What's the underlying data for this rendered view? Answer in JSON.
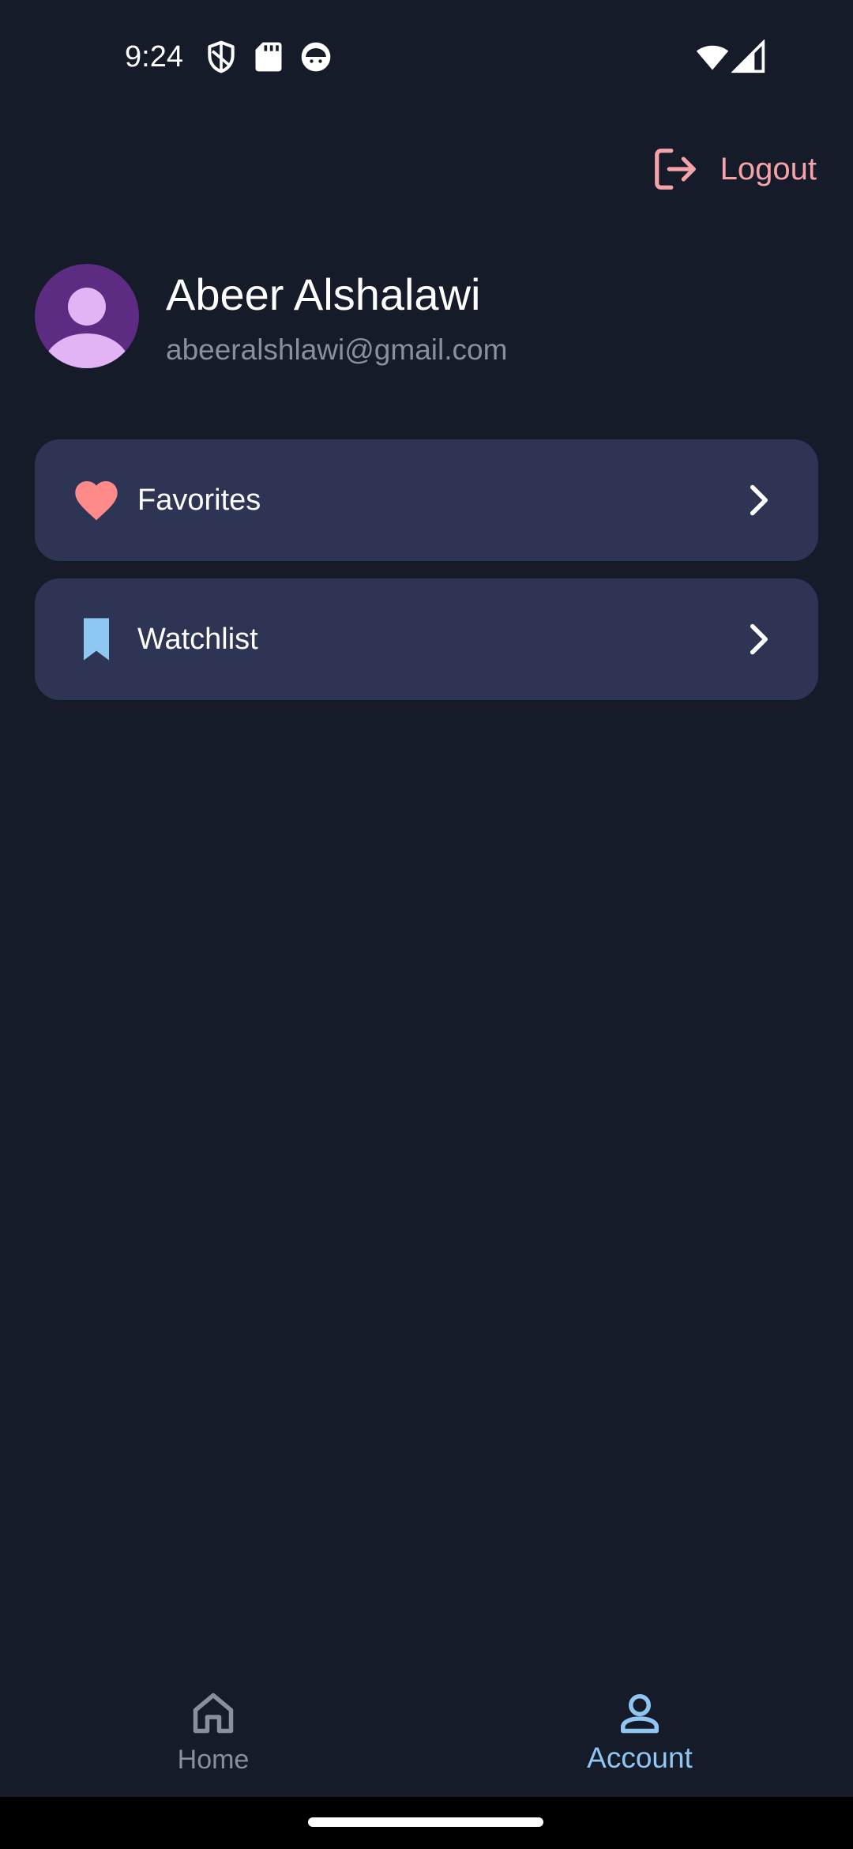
{
  "status_bar": {
    "time": "9:24",
    "icons": [
      "shield-icon",
      "sd-card-icon",
      "face-icon",
      "wifi-icon",
      "signal-icon"
    ]
  },
  "header": {
    "logout_label": "Logout",
    "logout_icon": "logout-icon"
  },
  "profile": {
    "name": "Abeer Alshalawi",
    "email": "abeeralshlawi@gmail.com",
    "avatar_icon": "person-icon"
  },
  "menu": {
    "items": [
      {
        "label": "Favorites",
        "icon": "heart-icon",
        "icon_color": "#ff8a8a"
      },
      {
        "label": "Watchlist",
        "icon": "bookmark-icon",
        "icon_color": "#8fc7f2"
      }
    ]
  },
  "bottom_nav": {
    "items": [
      {
        "label": "Home",
        "icon": "home-icon",
        "active": false
      },
      {
        "label": "Account",
        "icon": "account-icon",
        "active": true
      }
    ]
  },
  "colors": {
    "background": "#161b29",
    "card": "#2d3454",
    "accent_logout": "#f4a3a8",
    "accent_active": "#8fc7f2",
    "inactive": "#8a8f9e"
  }
}
